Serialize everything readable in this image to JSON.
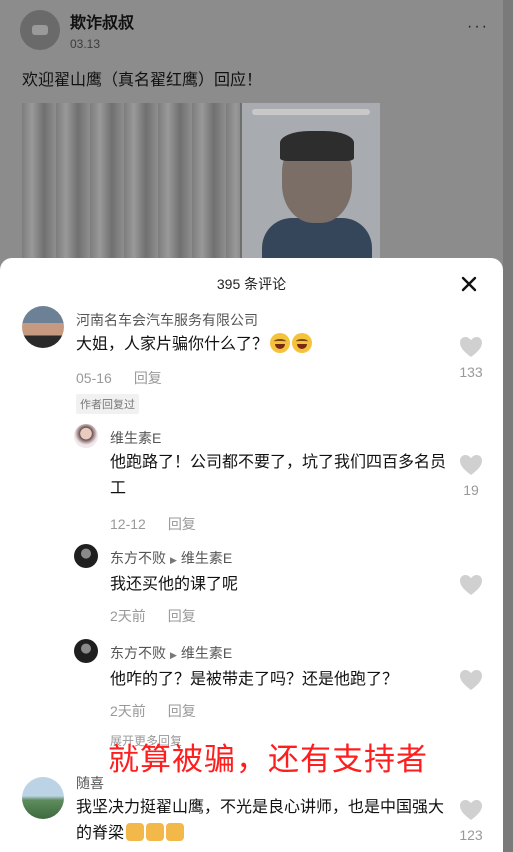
{
  "post": {
    "author": "欺诈叔叔",
    "date": "03.13",
    "more": "···",
    "text": "欢迎翟山鹰（真名翟红鹰）回应！"
  },
  "comments_header": {
    "title": "395 条评论"
  },
  "comments": [
    {
      "user": "河南名车会汽车服务有限公司",
      "text": "大姐，人家片骗你什么了？",
      "date": "05-16",
      "reply_label": "回复",
      "likes": "133",
      "tag": "作者回复过"
    },
    {
      "user": "维生素E",
      "text": "他跑路了！公司都不要了，坑了我们四百多名员工",
      "date": "12-12",
      "reply_label": "回复",
      "likes": "19"
    },
    {
      "user": "东方不败",
      "reply_to": "维生素E",
      "text": "我还买他的课了呢",
      "date": "2天前",
      "reply_label": "回复"
    },
    {
      "user": "东方不败",
      "reply_to": "维生素E",
      "text": "他咋的了？是被带走了吗？还是他跑了？",
      "date": "2天前",
      "reply_label": "回复"
    },
    {
      "user": "随喜",
      "text": "我坚决力挺翟山鹰，不光是良心讲师，也是中国强大的脊梁",
      "likes": "123"
    }
  ],
  "expand_replies": "展开更多回复",
  "overlay_caption": "就算被骗，还有支持者",
  "colors": {
    "overlay": "#ff1e1e",
    "sheet_bg": "#ffffff",
    "dim_bg": "#8c8c8c"
  }
}
